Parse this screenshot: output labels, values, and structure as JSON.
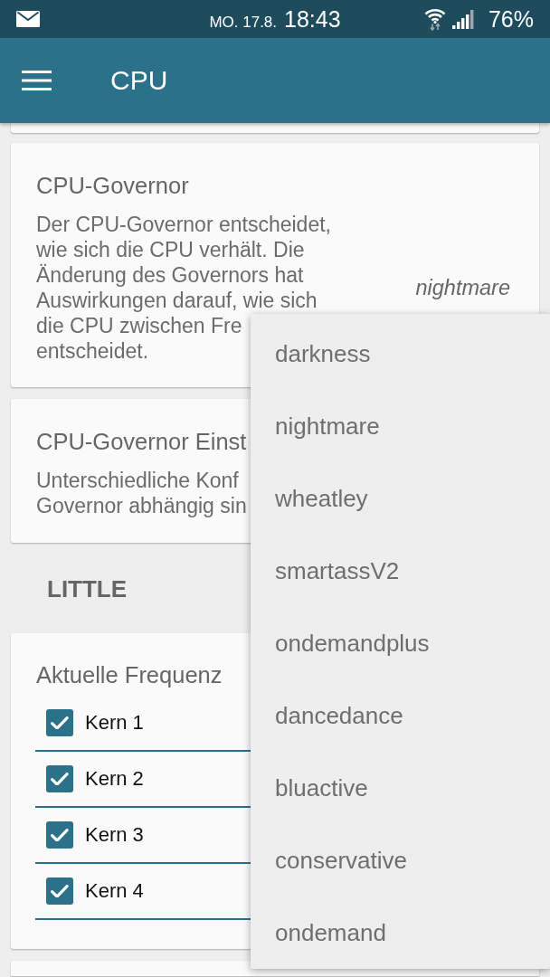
{
  "status_bar": {
    "date": "MO. 17.8.",
    "time": "18:43",
    "battery": "76%"
  },
  "app_bar": {
    "title": "CPU"
  },
  "cards": [
    {
      "title": "CPU-Governor",
      "description_lines": [
        "Der CPU-Governor entscheidet,",
        "wie sich die CPU verhält. Die",
        "Änderung des Governors hat",
        "Auswirkungen darauf, wie sich",
        "die CPU zwischen Fre",
        "entscheidet."
      ],
      "value": "nightmare"
    },
    {
      "title": "CPU-Governor Einst",
      "description_lines": [
        "Unterschiedliche Konf",
        "Governor abhängig sin"
      ]
    }
  ],
  "section": {
    "title": "LITTLE"
  },
  "frequency_card": {
    "title": "Aktuelle Frequenz",
    "cores": [
      {
        "label": "Kern 1",
        "checked": true
      },
      {
        "label": "Kern 2",
        "checked": true
      },
      {
        "label": "Kern 3",
        "checked": true
      },
      {
        "label": "Kern 4",
        "checked": true
      }
    ]
  },
  "dropdown": {
    "items": [
      {
        "label": "darkness",
        "selected": false
      },
      {
        "label": "nightmare",
        "selected": false
      },
      {
        "label": "wheatley",
        "selected": false
      },
      {
        "label": "smartassV2",
        "selected": false
      },
      {
        "label": "ondemandplus",
        "selected": false
      },
      {
        "label": "dancedance",
        "selected": false
      },
      {
        "label": "bluactive",
        "selected": false
      },
      {
        "label": "conservative",
        "selected": false
      },
      {
        "label": "ondemand",
        "selected": false
      }
    ]
  }
}
